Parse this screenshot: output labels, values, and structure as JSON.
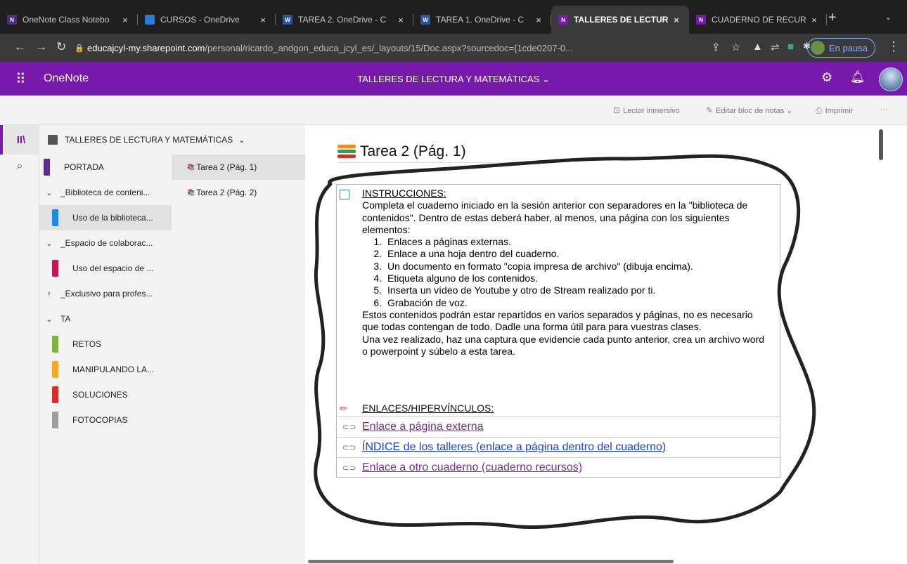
{
  "browser": {
    "tabs": [
      {
        "label": "OneNote Class Notebo",
        "icon": "onenote-class-icon",
        "color": "#4c2f7a",
        "glyph": "N",
        "active": false
      },
      {
        "label": "CURSOS - OneDrive",
        "icon": "onedrive-cloud-icon",
        "color": "#2b7cd3",
        "glyph": "",
        "active": false
      },
      {
        "label": "TAREA 2. OneDrive - C",
        "icon": "word-icon",
        "color": "#2b579a",
        "glyph": "W",
        "active": false
      },
      {
        "label": "TAREA 1. OneDrive - C",
        "icon": "word-icon",
        "color": "#2b579a",
        "glyph": "W",
        "active": false
      },
      {
        "label": "TALLERES DE LECTUR",
        "icon": "onenote-icon",
        "color": "#7719aa",
        "glyph": "N",
        "active": true
      },
      {
        "label": "CUADERNO DE RECUR",
        "icon": "onenote-icon",
        "color": "#7719aa",
        "glyph": "N",
        "active": false
      }
    ],
    "address": {
      "host": "educajcyl-my.sharepoint.com",
      "path": "/personal/ricardo_andgon_educa_jcyl_es/_layouts/15/Doc.aspx?sourcedoc={1cde0207-0..."
    },
    "profile_label": "En pausa"
  },
  "app": {
    "name": "OneNote",
    "notebook_title": "TALLERES DE LECTURA Y MATEMÁTICAS ⌄",
    "brand_color": "#7719aa"
  },
  "commands": {
    "immersive": "Lector inmersivo",
    "edit": "Editar bloc de notas ⌄",
    "print": "Imprimir",
    "more": "···"
  },
  "navigation": {
    "notebook_name": "TALLERES DE LECTURA Y MATEMÁTICAS",
    "sections": [
      {
        "label": "PORTADA",
        "type": "section",
        "color": "#5c2d91"
      },
      {
        "label": "_Biblioteca de conteni...",
        "type": "group",
        "expand": "⌄"
      },
      {
        "label": "Uso de la biblioteca...",
        "type": "section",
        "color": "#1e88e5",
        "indent": true,
        "selected": true
      },
      {
        "label": "_Espacio de colaborac...",
        "type": "group",
        "expand": "⌄"
      },
      {
        "label": "Uso del espacio de ...",
        "type": "section",
        "color": "#c2185b",
        "indent": true
      },
      {
        "label": "_Exclusivo para profes...",
        "type": "group",
        "expand": "›"
      },
      {
        "label": "TA",
        "type": "group",
        "expand": "⌄"
      },
      {
        "label": "RETOS",
        "type": "section",
        "color": "#7cb342",
        "indent": true
      },
      {
        "label": "MANIPULANDO LA...",
        "type": "section",
        "color": "#f9a825",
        "indent": true
      },
      {
        "label": "SOLUCIONES",
        "type": "section",
        "color": "#d32f2f",
        "indent": true
      },
      {
        "label": "FOTOCOPIAS",
        "type": "section",
        "color": "#9e9e9e",
        "indent": true
      }
    ],
    "pages": [
      {
        "label": "Tarea 2 (Pág. 1)",
        "selected": true
      },
      {
        "label": "Tarea 2 (Pág. 2)",
        "selected": false
      }
    ]
  },
  "page": {
    "title": "Tarea 2 (Pág. 1)",
    "instructions_heading": "INSTRUCCIONES:",
    "intro": "Completa el cuaderno iniciado en la sesión anterior con separadores en la \"biblioteca de contenidos\". Dentro de estas deberá haber, al menos, una página con los siguientes elementos:",
    "items": [
      "Enlaces a páginas externas.",
      "Enlace a una hoja dentro del cuaderno.",
      "Un documento en formato \"copia impresa de archivo\" (dibuja encima).",
      "Etiqueta alguno de los contenidos.",
      "Inserta un vídeo de Youtube y otro de Stream realizado por ti.",
      "Grabación de voz."
    ],
    "para2": "Estos contenidos podrán estar repartidos en varios separados y páginas, no es necesario que todas contengan de todo. Dadle una forma útil para para vuestras clases.",
    "para3": "Una vez realizado, haz una captura que evidencie cada punto anterior, crea un archivo word o powerpoint y súbelo a esta tarea.",
    "links_heading": "ENLACES/HIPERVÍNCULOS:",
    "links": [
      {
        "label": "Enlace a página externa",
        "color": "#7a2a94"
      },
      {
        "label": "ÍNDICE  de los talleres (enlace a página dentro del cuaderno)",
        "color": "#1a3fd1"
      },
      {
        "label": "Enlace a otro cuaderno (cuaderno recursos)",
        "color": "#7a2a94"
      }
    ]
  }
}
